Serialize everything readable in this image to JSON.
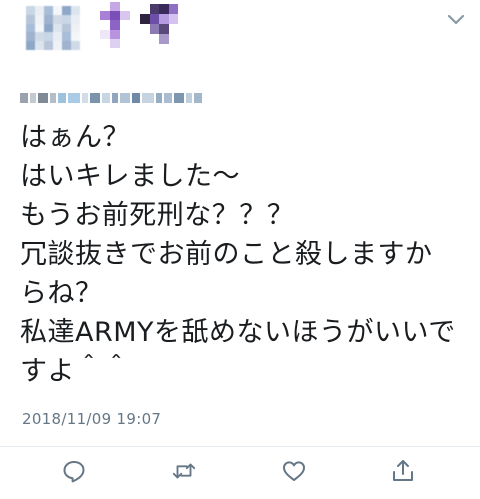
{
  "tweet": {
    "lines": [
      "はぁん？",
      "はいキレました〜",
      "もうお前死刑な？？？",
      "冗談抜きでお前のこと殺しますか",
      "らね？",
      "私達ARMYを舐めないほうがいいで",
      "すよ＾＾"
    ],
    "timestamp": "2018/11/09 19:07"
  },
  "actions": {
    "reply_icon": "reply-icon",
    "retweet_icon": "retweet-icon",
    "like_icon": "heart-icon",
    "share_icon": "share-icon"
  },
  "colors": {
    "text": "#1a1d20",
    "muted": "#657786",
    "icon": "#657786",
    "divider": "#e6ecf0"
  }
}
